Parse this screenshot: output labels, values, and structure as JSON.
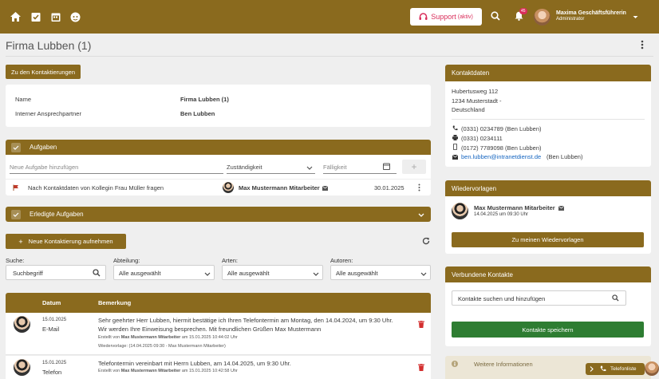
{
  "header": {
    "support_label": "Support",
    "support_suffix": "(aktiv)",
    "notification_count": "45",
    "user_name": "Maxima Geschäftsführerin",
    "user_role": "Administrator"
  },
  "page": {
    "title": "Firma Lubben (1)"
  },
  "overview": {
    "back_button": "Zu den Kontaktierungen",
    "name_label": "Name",
    "name_value": "Firma Lubben (1)",
    "contact_label": "Interner Ansprechpartner",
    "contact_value": "Ben Lubben"
  },
  "tasks": {
    "title": "Aufgaben",
    "new_placeholder": "Neue Aufgabe hinzufügen",
    "responsible_placeholder": "Zuständigkeit",
    "due_placeholder": "Fälligkeit",
    "add_symbol": "+",
    "items": [
      {
        "text": "Nach Kontaktdaten von Kollegin Frau Müller fragen",
        "assignee": "Max Mustermann Mitarbeiter",
        "date": "30.01.2025"
      }
    ]
  },
  "done_tasks": {
    "title": "Erledigte Aufgaben"
  },
  "contacting": {
    "new_button": "Neue Kontaktierung aufnehmen",
    "new_button_symbol": "+",
    "filters": {
      "search_label": "Suche:",
      "search_placeholder": "Suchbegriff",
      "department_label": "Abteilung:",
      "department_value": "Alle ausgewählt",
      "types_label": "Arten:",
      "types_value": "Alle ausgewählt",
      "authors_label": "Autoren:",
      "authors_value": "Alle ausgewählt"
    },
    "columns": {
      "date": "Datum",
      "remark": "Bemerkung"
    },
    "rows": [
      {
        "date": "15.01.2025",
        "type": "E-Mail",
        "text_line1": "Sehr geehrter Herr Lubben, hiermit bestätige ich Ihren Telefontermin am Montag, den 14.04.2024, um 9:30 Uhr.",
        "text_line2": "Wir werden Ihre Einweisung besprechen. Mit freundlichen Grüßen Max Mustermann",
        "created_prefix": "Erstellt von",
        "created_by": "Max Mustermann Mitarbeiter",
        "created_suffix": "am 15.01.2025 10:44:02 Uhr",
        "followup": "Wiedervorlage: (14.04.2025 09:30 - Max Mustermann Mitarbeiter)"
      },
      {
        "date": "15.01.2025",
        "type": "Telefon",
        "text_line1": "Telefontermin vereinbart mit Herrn Lubben, am 14.04.2025, um 9:30 Uhr.",
        "created_prefix": "Erstellt von",
        "created_by": "Max Mustermann Mitarbeiter",
        "created_suffix": "am 15.01.2025 10:42:58 Uhr"
      }
    ]
  },
  "contact_data": {
    "title": "Kontaktdaten",
    "street": "Hubertusweg 112",
    "city": "1234 Musterstadt -",
    "country": "Deutschland",
    "phone": "(0331) 0234789 (Ben Lubben)",
    "fax": "(0331) 0234111",
    "mobile": "(0172) 7789098 (Ben Lubben)",
    "email": "ben.lubben@intranetdienst.de",
    "email_suffix": "(Ben Lubben)"
  },
  "followups": {
    "title": "Wiedervorlagen",
    "person": "Max Mustermann Mitarbeiter",
    "datetime": "14.04.2025 um 09:30 Uhr",
    "button": "Zu meinen Wiedervorlagen"
  },
  "linked_contacts": {
    "title": "Verbundene Kontakte",
    "search_placeholder": "Kontakte suchen und hinzufügen",
    "save_button": "Kontakte speichern"
  },
  "more_info": {
    "title": "Weitere Informationen"
  },
  "phone_list": {
    "label": "Telefonliste"
  },
  "colors": {
    "gold": "#8a6a1e",
    "green": "#2e7d32",
    "red": "#d32f2f",
    "pink": "#d92d5a"
  }
}
